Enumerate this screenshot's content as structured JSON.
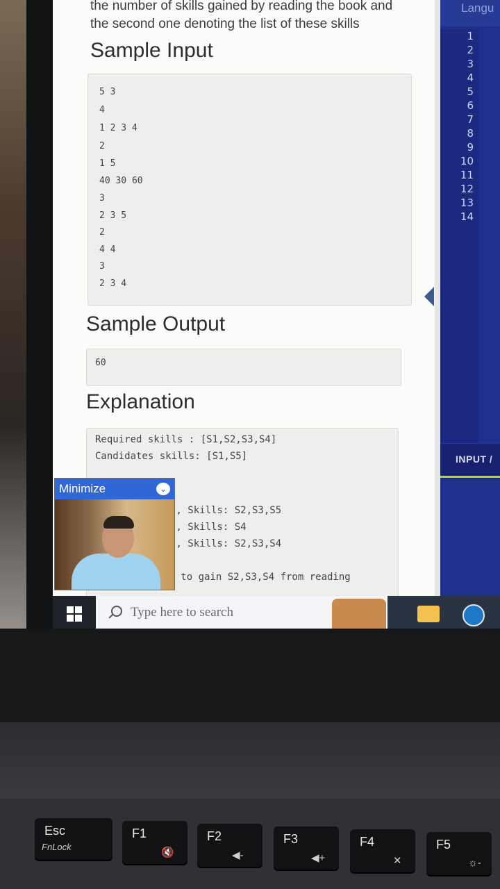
{
  "problem": {
    "intro_line1": "the number of skills gained by reading the book and",
    "intro_line2": "the second one denoting the list of these skills",
    "sample_input_heading": "Sample Input",
    "sample_input_lines": [
      "5 3",
      "4",
      "1 2 3 4",
      "2",
      "1 5",
      "40 30 60",
      "3",
      "2 3 5",
      "2",
      "4 4",
      "3",
      "2 3 4"
    ],
    "sample_output_heading": "Sample Output",
    "sample_output_value": "60",
    "explanation_heading": "Explanation",
    "explanation_lines": [
      "Required skills : [S1,S2,S3,S4]",
      "Candidates skills: [S1,S5]",
      "), Skills: S2,S3,S5",
      "), Skills: S4",
      "), Skills: S2,S3,S4",
      "ed to gain S2,S3,S4 from reading"
    ]
  },
  "editor": {
    "language_label": "Langu",
    "line_numbers": [
      "1",
      "2",
      "3",
      "4",
      "5",
      "6",
      "7",
      "8",
      "9",
      "10",
      "11",
      "12",
      "13",
      "14"
    ],
    "input_tab_label": "INPUT /"
  },
  "webcam": {
    "minimize_label": "Minimize",
    "minimize_icon": "chevron-down-icon"
  },
  "taskbar": {
    "search_placeholder": "Type here to search"
  },
  "keyboard": {
    "keys": [
      {
        "main": "Esc",
        "sub": "FnLock",
        "icon": ""
      },
      {
        "main": "F1",
        "sub": "",
        "icon": "mute-icon"
      },
      {
        "main": "F2",
        "sub": "",
        "icon": "volume-down-icon"
      },
      {
        "main": "F3",
        "sub": "",
        "icon": "volume-up-icon"
      },
      {
        "main": "F4",
        "sub": "",
        "icon": "mic-mute-icon"
      },
      {
        "main": "F5",
        "sub": "",
        "icon": "brightness-down-icon"
      }
    ]
  }
}
